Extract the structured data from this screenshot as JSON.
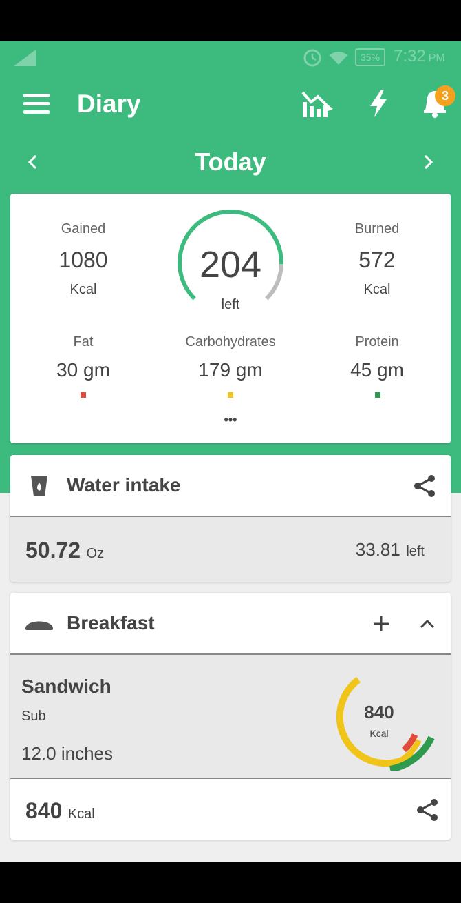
{
  "status_bar": {
    "battery": "35%",
    "time": "7:32",
    "ampm": "PM"
  },
  "header": {
    "title": "Diary",
    "notification_count": "3"
  },
  "date_nav": {
    "label": "Today"
  },
  "summary": {
    "gained_label": "Gained",
    "gained_value": "1080",
    "gained_unit": "Kcal",
    "left_value": "204",
    "left_label": "left",
    "left_progress": 0.84,
    "burned_label": "Burned",
    "burned_value": "572",
    "burned_unit": "Kcal",
    "fat_label": "Fat",
    "fat_value": "30 gm",
    "carb_label": "Carbohydrates",
    "carb_value": "179 gm",
    "protein_label": "Protein",
    "protein_value": "45 gm",
    "more": "•••"
  },
  "water": {
    "title": "Water intake",
    "amount": "50.72",
    "amount_unit": "Oz",
    "left_value": "33.81",
    "left_label": "left"
  },
  "breakfast": {
    "title": "Breakfast",
    "item_name": "Sandwich",
    "item_variant": "Sub",
    "item_size": "12.0  inches",
    "item_kcal": "840",
    "item_kcal_unit": "Kcal",
    "total_value": "840",
    "total_unit": "Kcal"
  },
  "colors": {
    "accent": "#3dbb7f",
    "fat": "#e04b3a",
    "carb": "#f0c419",
    "protein": "#2e9a4e"
  }
}
